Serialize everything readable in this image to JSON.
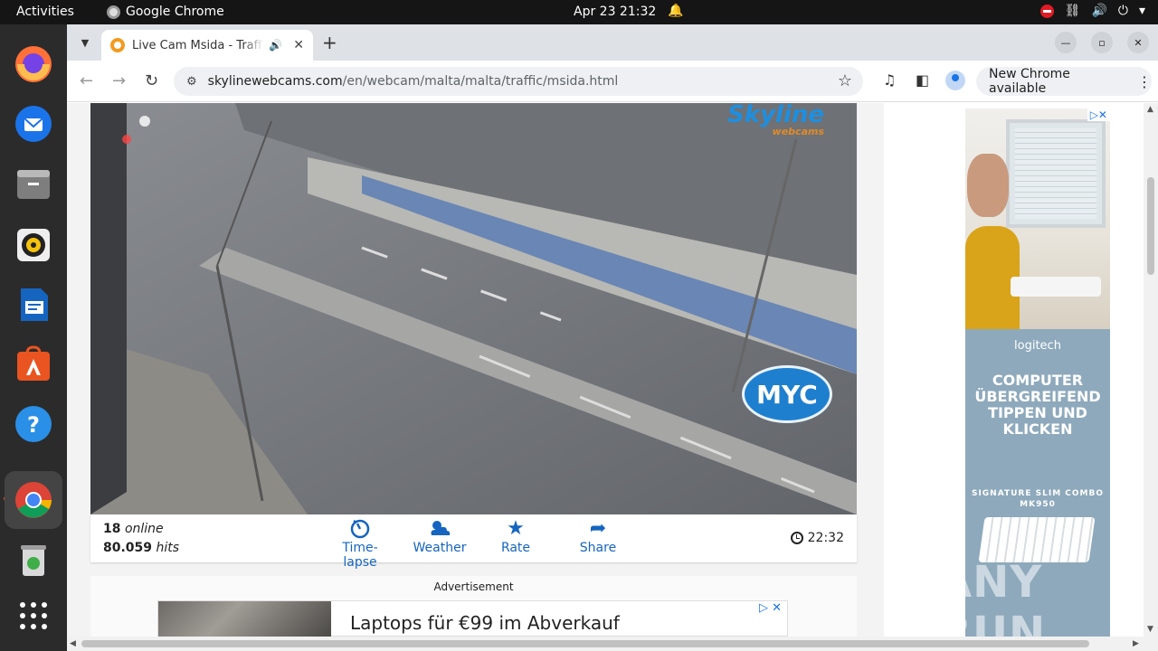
{
  "topbar": {
    "activities": "Activities",
    "app_name": "Google Chrome",
    "datetime": "Apr 23  21:32"
  },
  "dock": {
    "items": [
      "firefox-icon",
      "thunderbird-icon",
      "files-icon",
      "rhythmbox-icon",
      "writer-icon",
      "app-center-icon",
      "help-icon",
      "chrome-icon",
      "trash-icon",
      "app-grid-icon"
    ]
  },
  "browser": {
    "tab_title": "Live Cam Msida - Traffic",
    "url_host": "skylinewebcams.com",
    "url_path": "/en/webcam/malta/malta/traffic/msida.html",
    "update_label": "New Chrome available"
  },
  "webcam": {
    "logo": "Skyline",
    "logo_sub": "webcams",
    "overlay_logo": "MYC"
  },
  "stats": {
    "online_count": "18",
    "online_label": "online",
    "hits_count": "80.059",
    "hits_label": "hits",
    "local_time": "22:32"
  },
  "actions": [
    {
      "label": "Time-lapse",
      "icon": "timelapse-icon"
    },
    {
      "label": "Weather",
      "icon": "weather-icon"
    },
    {
      "label": "Rate",
      "icon": "star-icon"
    },
    {
      "label": "Share",
      "icon": "share-icon"
    }
  ],
  "ad_bottom": {
    "label": "Advertisement",
    "headline": "Laptops für €99 im Abverkauf"
  },
  "ad_side": {
    "brand": "logitech",
    "heading": "COMPUTER ÜBERGREIFEND TIPPEN UND KLICKEN",
    "product": "SIGNATURE SLIM COMBO MK950"
  },
  "watermark": "ANY RUN",
  "colors": {
    "accent": "#1565c0",
    "skyline_blue": "#1e8fe0",
    "record": "#e01b24"
  }
}
